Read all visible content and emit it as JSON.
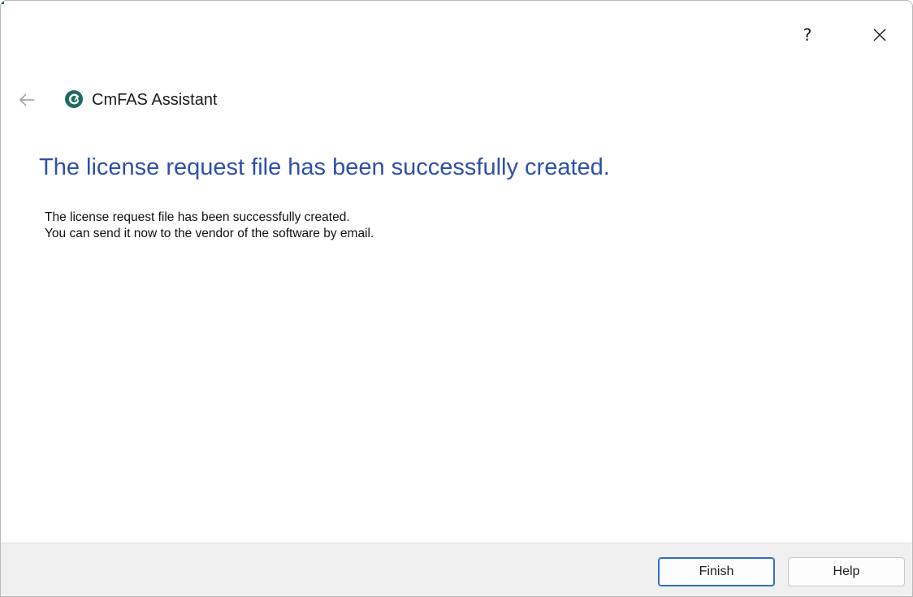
{
  "window": {
    "help_glyph": "?",
    "close_icon": "close-icon",
    "accent_color": "#1f5f55"
  },
  "nav": {
    "back_icon": "arrow-left-icon",
    "app_icon": "cmfas-logo-icon",
    "app_title": "CmFAS Assistant"
  },
  "content": {
    "heading": "The license request file has been successfully created.",
    "heading_color": "#2e50a8",
    "lines": [
      "The license request file has been successfully created.",
      "You can send it now to the vendor of the software by email."
    ]
  },
  "footer": {
    "finish_label": "Finish",
    "help_label": "Help"
  }
}
